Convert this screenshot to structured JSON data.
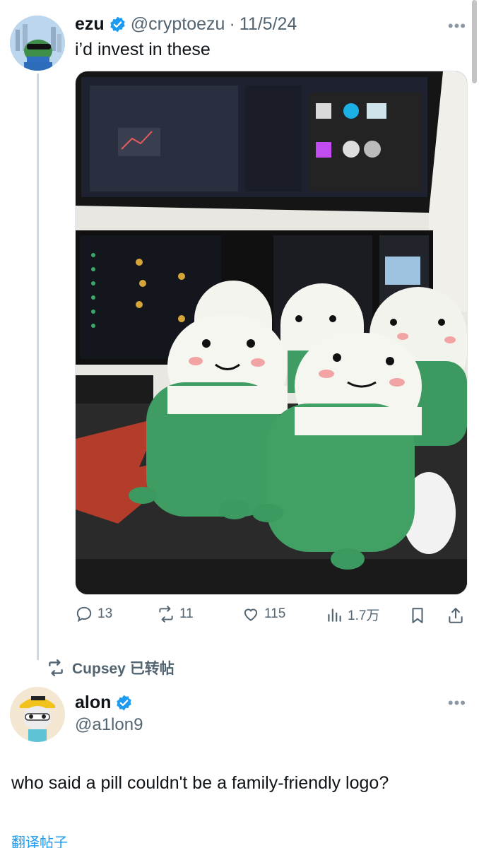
{
  "tweet1": {
    "name": "ezu",
    "handle": "@cryptoezu",
    "separator": "·",
    "date": "11/5/24",
    "text": "i’d invest in these",
    "media_description_icon": "photo-pill-plushies",
    "actions": {
      "replies": "13",
      "reposts": "11",
      "likes": "115",
      "views": "1.7万"
    }
  },
  "repost_banner": {
    "text": "Cupsey 已转帖"
  },
  "tweet2": {
    "name": "alon",
    "handle": "@a1lon9",
    "text": "who said a pill couldn't be a family-friendly logo?",
    "translate": "翻译帖子"
  },
  "icons": {
    "more": "more-icon",
    "verified": "verified-badge-icon"
  },
  "colors": {
    "verified_blue": "#1d9bf0",
    "muted_text": "#536471",
    "link_blue": "#1d9bf0",
    "thread_line": "#cfd9de"
  }
}
